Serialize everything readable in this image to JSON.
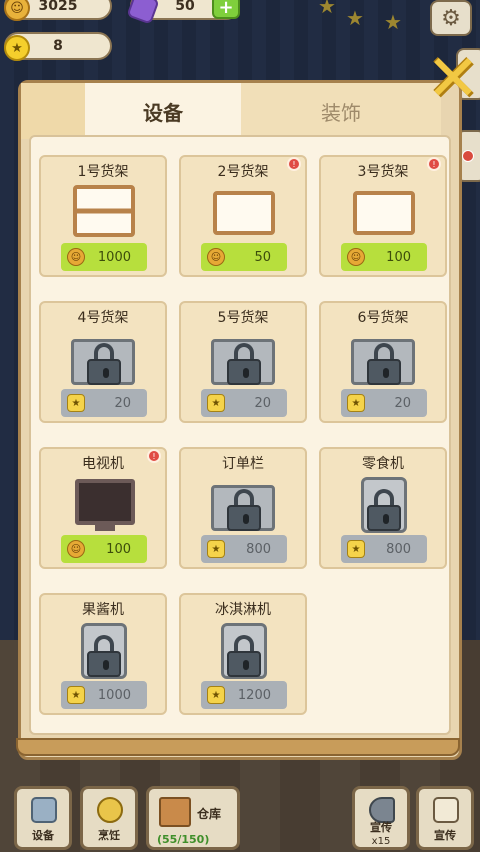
{
  "hud": {
    "coins": "3025",
    "gems": "50",
    "stars": "8",
    "plus_icon": "plus-icon",
    "settings_icon": "gear-icon"
  },
  "tabs": [
    {
      "label": "设备",
      "active": true
    },
    {
      "label": "装饰",
      "active": false
    }
  ],
  "items": [
    {
      "name": "1号货架",
      "price": "1000",
      "currency": "coin",
      "locked": false,
      "badge": false,
      "art": "shelf"
    },
    {
      "name": "2号货架",
      "price": "50",
      "currency": "coin",
      "locked": false,
      "badge": true,
      "art": "shelf-wide"
    },
    {
      "name": "3号货架",
      "price": "100",
      "currency": "coin",
      "locked": false,
      "badge": true,
      "art": "shelf-wide"
    },
    {
      "name": "4号货架",
      "price": "20",
      "currency": "star",
      "locked": true,
      "badge": false,
      "art": "shelf-locked"
    },
    {
      "name": "5号货架",
      "price": "20",
      "currency": "star",
      "locked": true,
      "badge": false,
      "art": "shelf-locked"
    },
    {
      "name": "6号货架",
      "price": "20",
      "currency": "star",
      "locked": true,
      "badge": false,
      "art": "shelf-locked"
    },
    {
      "name": "电视机",
      "price": "100",
      "currency": "coin",
      "locked": false,
      "badge": true,
      "art": "tv"
    },
    {
      "name": "订单栏",
      "price": "800",
      "currency": "star",
      "locked": true,
      "badge": false,
      "art": "board-locked"
    },
    {
      "name": "零食机",
      "price": "800",
      "currency": "star",
      "locked": true,
      "badge": false,
      "art": "machine-locked"
    },
    {
      "name": "果酱机",
      "price": "1000",
      "currency": "star",
      "locked": true,
      "badge": false,
      "art": "machine-locked"
    },
    {
      "name": "冰淇淋机",
      "price": "1200",
      "currency": "star",
      "locked": true,
      "badge": false,
      "art": "machine-locked"
    }
  ],
  "toolbar": {
    "equipment_label": "设备",
    "cooking_label": "烹饪",
    "warehouse_label": "仓库",
    "warehouse_count": "(55/150)",
    "promo_label": "宣传",
    "promo_sub": "x15",
    "promo2_label": "宣传"
  },
  "colors": {
    "price_active": "#b7df3d",
    "price_locked": "#aab0b6",
    "badge": "#e04b43"
  }
}
